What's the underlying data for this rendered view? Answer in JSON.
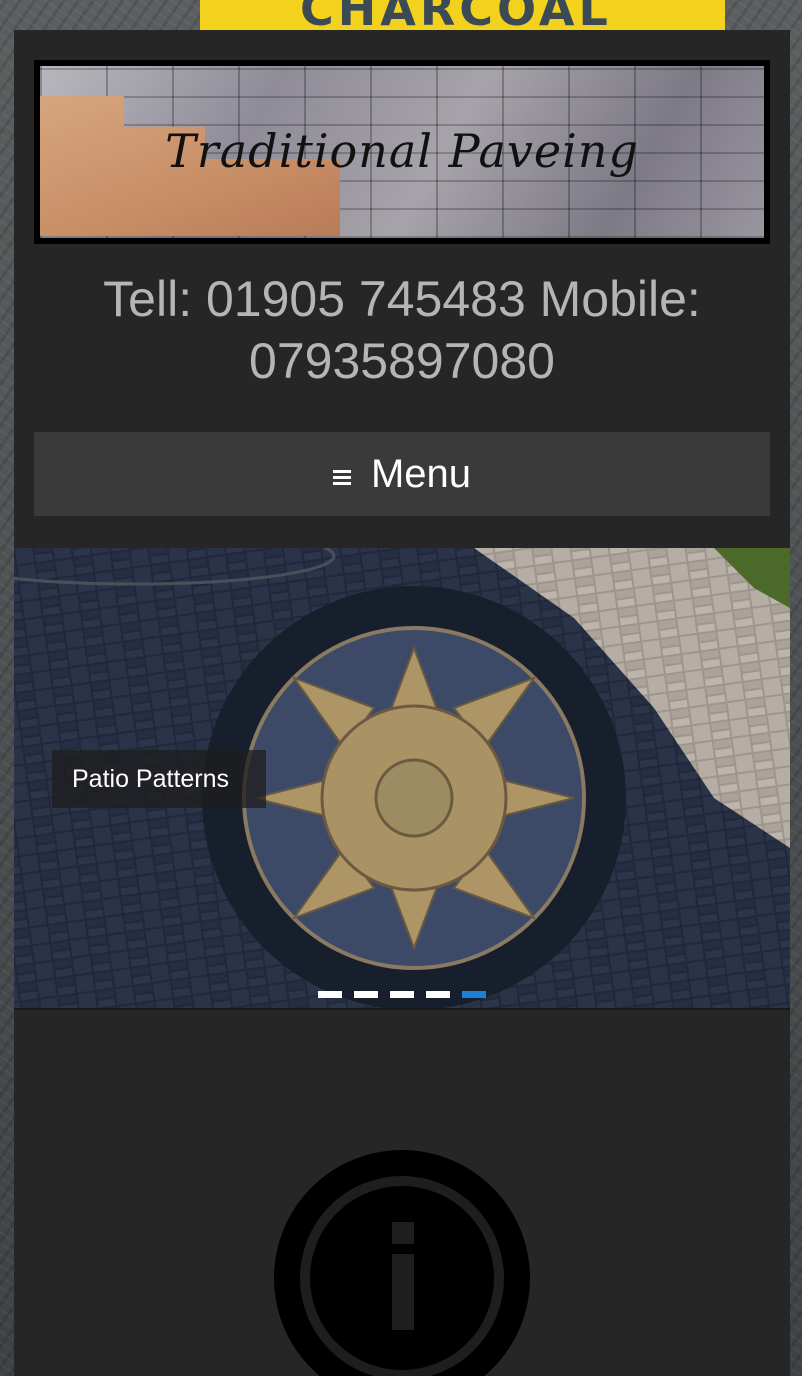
{
  "header": {
    "logo_text": "Traditional Paveing",
    "phone_line_1": "Tell: 01905 745483 Mobile:",
    "phone_line_2": "07935897080"
  },
  "nav": {
    "menu_label": "Menu",
    "menu_icon": "hamburger-icon"
  },
  "slider": {
    "caption": "Patio Patterns",
    "slide_count": 5,
    "active_slide": 5
  },
  "info_section": {
    "icon": "info-icon"
  },
  "colors": {
    "page_bg": "#262626",
    "menu_bg": "#3a3a3a",
    "phone_text": "#b5b5b5",
    "active_dot": "#1e7fd6",
    "sign_yellow": "#f3d21e"
  }
}
